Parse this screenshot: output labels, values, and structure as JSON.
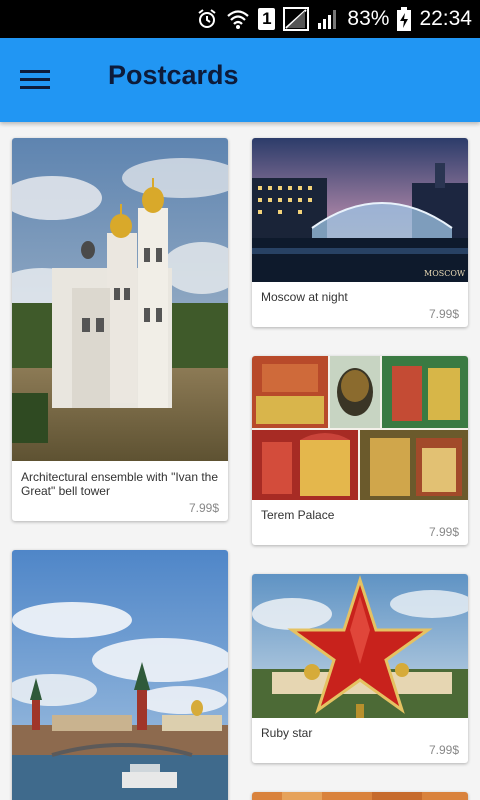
{
  "status_bar": {
    "battery_percent": "83%",
    "time": "22:34",
    "sim_label": "1",
    "icons": [
      "alarm-icon",
      "wifi-icon",
      "sim-icon",
      "no-signal-icon",
      "signal-icon",
      "battery-charging-icon"
    ]
  },
  "app_bar": {
    "title": "Postcards",
    "menu_icon": "hamburger-menu-icon",
    "color": "#2196f3"
  },
  "postcards": [
    {
      "title": "Architectural ensemble with \"Ivan the Great\" bell tower",
      "price": "7.99$"
    },
    {
      "title": "Moscow at night",
      "price": "7.99$"
    },
    {
      "title": "Terem Palace",
      "price": "7.99$"
    },
    {
      "title": "Ruby star",
      "price": "7.99$"
    },
    {
      "title": "",
      "price": ""
    },
    {
      "title": "",
      "price": ""
    }
  ]
}
